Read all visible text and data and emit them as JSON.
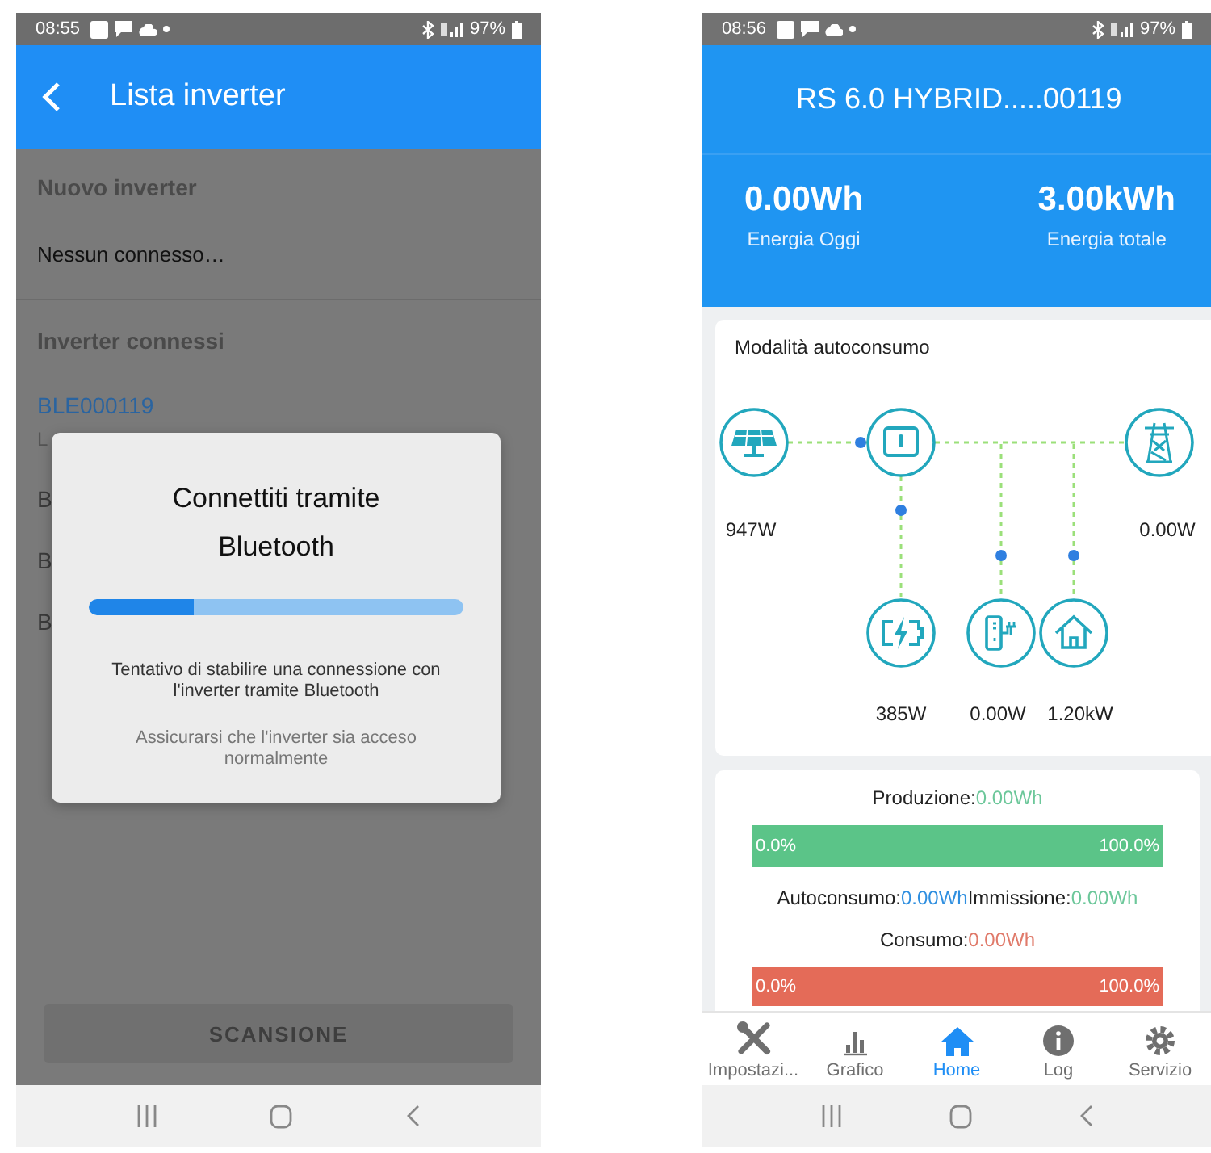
{
  "left_screen": {
    "status_bar": {
      "time": "08:55",
      "battery": "97%"
    },
    "header": {
      "title": "Lista inverter"
    },
    "new_section": {
      "heading": "Nuovo inverter",
      "text": "Nessun connesso…"
    },
    "connected_section": {
      "heading": "Inverter connessi",
      "devices": [
        {
          "name": "BLE000119",
          "status": "L",
          "selected": true
        },
        {
          "name": "B",
          "selected": false
        },
        {
          "name": "B",
          "selected": false
        },
        {
          "name": "B",
          "selected": false
        }
      ]
    },
    "dialog": {
      "title": "Connettiti tramite Bluetooth",
      "level": 0.28,
      "message": "Tentativo di stabilire una connessione con l'inverter tramite Bluetooth",
      "hint": "Assicurarsi che l'inverter sia acceso normalmente"
    },
    "scan_button": "SCANSIONE"
  },
  "right_screen": {
    "status_bar": {
      "time": "08:56",
      "battery": "97%"
    },
    "header": {
      "title": "RS 6.0 HYBRID.....00119"
    },
    "stats": [
      {
        "value": "0.00Wh",
        "label": "Energia Oggi"
      },
      {
        "value": "3.00kWh",
        "label": "Energia totale"
      }
    ],
    "flow": {
      "title": "Modalità autoconsumo",
      "nodes": [
        {
          "kind": "solar",
          "reading": "947W"
        },
        {
          "kind": "inverter"
        },
        {
          "kind": "grid",
          "reading": "0.00W"
        },
        {
          "kind": "battery",
          "reading": "385W"
        },
        {
          "kind": "charger",
          "reading": "0.00W"
        },
        {
          "kind": "home",
          "reading": "1.20kW"
        }
      ]
    },
    "summary": {
      "production": {
        "label": "Produzione:",
        "value": "0.00Wh",
        "start": "0.0%",
        "end": "100.0%"
      },
      "split": [
        {
          "label": "Autoconsumo:",
          "value": "0.00Wh",
          "color": "#2f8fe0"
        },
        {
          "label": "Immissione:",
          "value": "0.00Wh",
          "color": "#6cc79a"
        }
      ],
      "consumption": {
        "label": "Consumo:",
        "value": "0.00Wh",
        "start": "0.0%",
        "end": "100.0%"
      }
    },
    "tabs": [
      {
        "kind": "tools",
        "label": "Impostazi...",
        "selected": false
      },
      {
        "kind": "chart",
        "label": "Grafico",
        "selected": false
      },
      {
        "kind": "home",
        "label": "Home",
        "selected": true
      },
      {
        "kind": "info",
        "label": "Log",
        "selected": false
      },
      {
        "kind": "gear",
        "label": "Servizio",
        "selected": false
      }
    ]
  }
}
